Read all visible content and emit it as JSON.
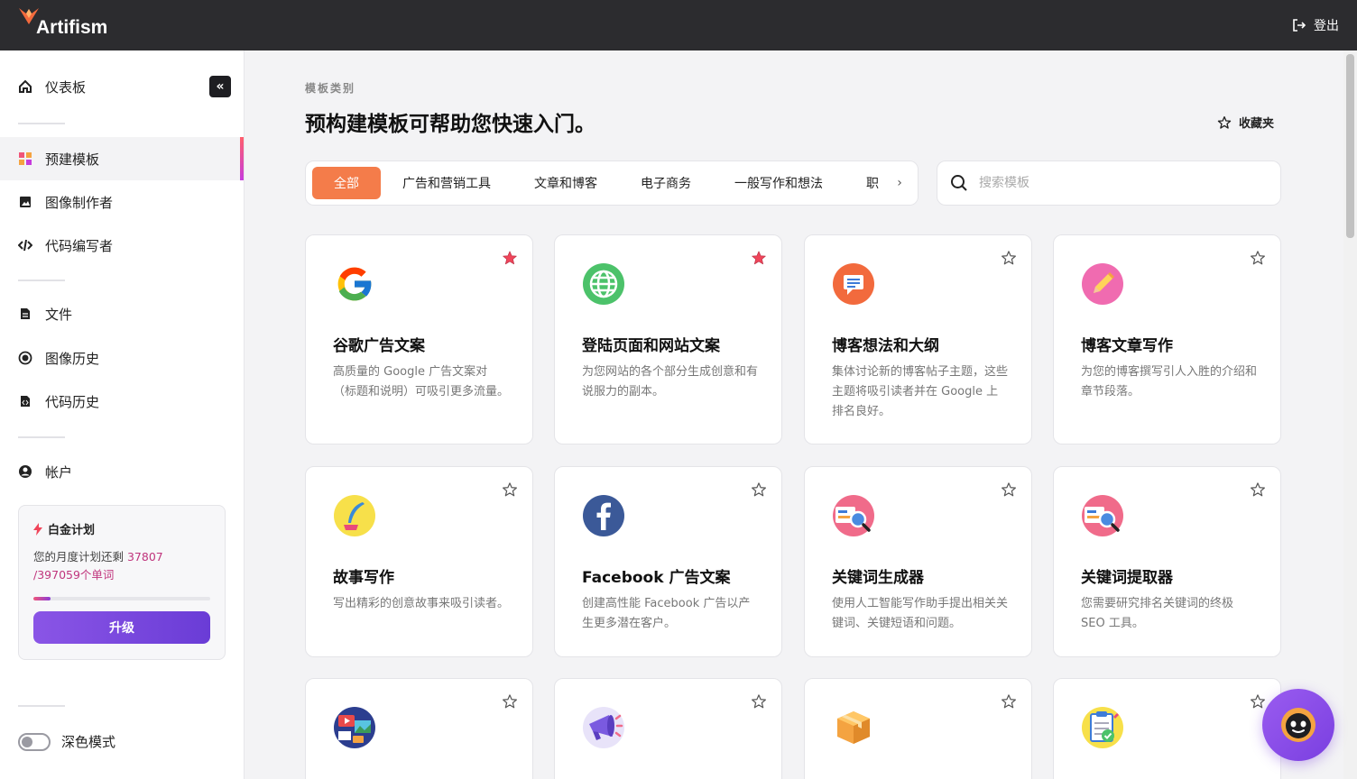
{
  "app": {
    "logo_text": "Artifism",
    "logout_label": "登出"
  },
  "sidebar": {
    "dashboard": "仪表板",
    "collapse_glyph": "«",
    "items": [
      {
        "label": "预建模板",
        "icon": "templates-icon"
      },
      {
        "label": "图像制作者",
        "icon": "image-icon"
      },
      {
        "label": "代码编写者",
        "icon": "code-icon"
      },
      {
        "label": "文件",
        "icon": "file-icon"
      },
      {
        "label": "图像历史",
        "icon": "history-icon"
      },
      {
        "label": "代码历史",
        "icon": "code-file-icon"
      },
      {
        "label": "帐户",
        "icon": "account-icon"
      }
    ],
    "plan": {
      "title": "白金计划",
      "text_prefix": "您的月度计划还剩 ",
      "remaining": "37807",
      "total": "/397059个单词",
      "progress": 0.095,
      "upgrade_label": "升级"
    },
    "dark_mode_label": "深色模式"
  },
  "main": {
    "subheading": "模板类别",
    "headline": "预构建模板可帮助您快速入门。",
    "favorites_label": "收藏夹",
    "tabs": [
      "全部",
      "广告和营销工具",
      "文章和博客",
      "电子商务",
      "一般写作和想法",
      "职"
    ],
    "tab_more_glyph": "›",
    "search_placeholder": "搜索模板"
  },
  "cards": [
    {
      "title": "谷歌广告文案",
      "desc": "高质量的 Google 广告文案对（标题和说明）可吸引更多流量。",
      "favorite": true,
      "icon": "google-icon"
    },
    {
      "title": "登陆页面和网站文案",
      "desc": "为您网站的各个部分生成创意和有说服力的副本。",
      "favorite": true,
      "icon": "globe-icon"
    },
    {
      "title": "博客想法和大纲",
      "desc": "集体讨论新的博客帖子主题，这些主题将吸引读者并在 Google 上排名良好。",
      "favorite": false,
      "icon": "blog-ideas-icon"
    },
    {
      "title": "博客文章写作",
      "desc": "为您的博客撰写引人入胜的介绍和章节段落。",
      "favorite": false,
      "icon": "pencil-icon"
    },
    {
      "title": "故事写作",
      "desc": "写出精彩的创意故事来吸引读者。",
      "favorite": false,
      "icon": "quill-icon"
    },
    {
      "title": "Facebook 广告文案",
      "desc": "创建高性能 Facebook 广告以产生更多潜在客户。",
      "favorite": false,
      "icon": "facebook-icon"
    },
    {
      "title": "关键词生成器",
      "desc": "使用人工智能写作助手提出相关关键词、关键短语和问题。",
      "favorite": false,
      "icon": "keyword-search-icon"
    },
    {
      "title": "关键词提取器",
      "desc": "您需要研究排名关键词的终极 SEO 工具。",
      "favorite": false,
      "icon": "keyword-extract-icon"
    },
    {
      "title": "",
      "desc": "",
      "favorite": false,
      "icon": "video-media-icon"
    },
    {
      "title": "",
      "desc": "",
      "favorite": false,
      "icon": "megaphone-icon"
    },
    {
      "title": "",
      "desc": "",
      "favorite": false,
      "icon": "package-icon"
    },
    {
      "title": "",
      "desc": "",
      "favorite": false,
      "icon": "checklist-icon"
    }
  ],
  "colors": {
    "accent": "#f47c4a",
    "topbar": "#2c2c2f",
    "favorite_star": "#f0455a",
    "upgrade": "#7a45e0"
  }
}
